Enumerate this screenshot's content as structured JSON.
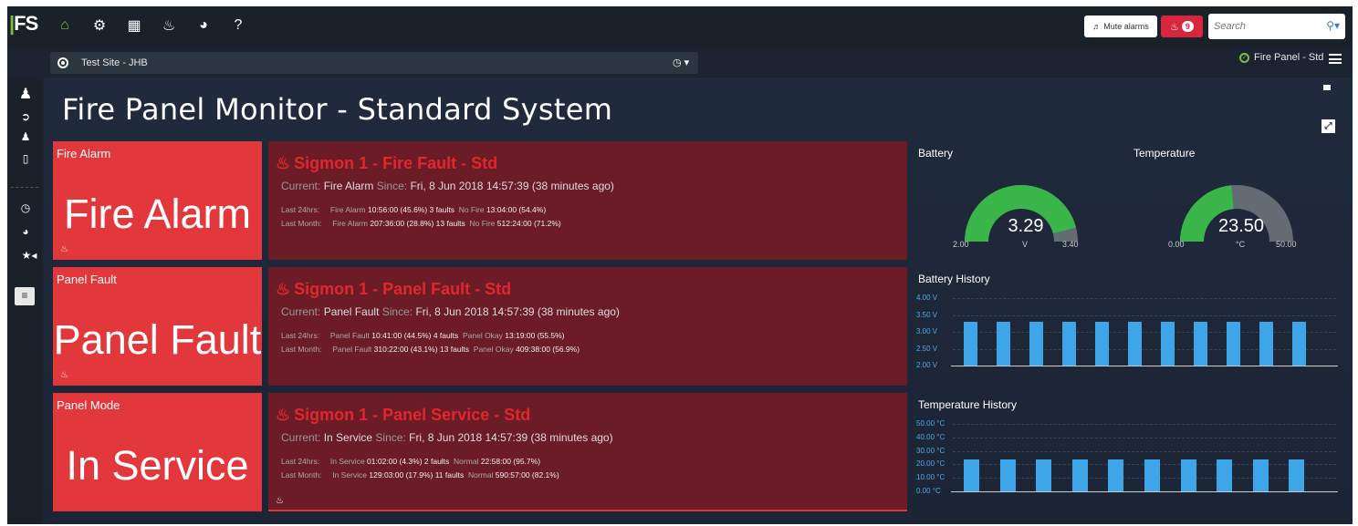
{
  "app": {
    "logo": "FS",
    "nav_icons": [
      "home-icon",
      "gear-icon",
      "table-icon",
      "bell-icon",
      "dashboard-icon",
      "help-icon"
    ],
    "mute_alarms": "Mute alarms",
    "alarm_count": "9",
    "search_placeholder": "Search"
  },
  "site": {
    "name": "Test Site - JHB",
    "panel_selector": "Fire Panel - Std"
  },
  "page": {
    "title": "Fire Panel Monitor - Standard System"
  },
  "tiles": [
    {
      "label": "Fire Alarm",
      "value": "Fire Alarm"
    },
    {
      "label": "Panel Fault",
      "value": "Panel Fault"
    },
    {
      "label": "Panel Mode",
      "value": "In Service"
    }
  ],
  "details": [
    {
      "title": "Sigmon 1 - Fire Fault - Std",
      "current_label": "Current:",
      "current_value": "Fire Alarm",
      "since_label": "Since:",
      "since_value": "Fri, 8 Jun 2018   14:57:39 (38 minutes ago)",
      "l24_label": "Last 24hrs:",
      "l24_a_name": "Fire Alarm",
      "l24_a_val": "10:56:00 (45.6%) 3 faults",
      "l24_b_name": "No Fire",
      "l24_b_val": "13:04:00 (54.4%)",
      "lm_label": "Last Month:",
      "lm_a_name": "Fire Alarm",
      "lm_a_val": "207:36:00 (28.8%) 13 faults",
      "lm_b_name": "No Fire",
      "lm_b_val": "512:24:00 (71.2%)"
    },
    {
      "title": "Sigmon 1 - Panel Fault - Std",
      "current_label": "Current:",
      "current_value": "Panel Fault",
      "since_label": "Since:",
      "since_value": "Fri, 8 Jun 2018   14:57:39 (38 minutes ago)",
      "l24_label": "Last 24hrs:",
      "l24_a_name": "Panel Fault",
      "l24_a_val": "10:41:00 (44.5%) 4 faults",
      "l24_b_name": "Panel Okay",
      "l24_b_val": "13:19:00 (55.5%)",
      "lm_label": "Last Month:",
      "lm_a_name": "Panel Fault",
      "lm_a_val": "310:22:00 (43.1%) 13 faults",
      "lm_b_name": "Panel Okay",
      "lm_b_val": "409:38:00 (56.9%)"
    },
    {
      "title": "Sigmon 1 - Panel Service - Std",
      "current_label": "Current:",
      "current_value": "In Service",
      "since_label": "Since:",
      "since_value": "Fri, 8 Jun 2018   14:57:39 (38 minutes ago)",
      "l24_label": "Last 24hrs:",
      "l24_a_name": "In Service",
      "l24_a_val": "01:02:00 (4.3%) 2 faults",
      "l24_b_name": "Normal",
      "l24_b_val": "22:58:00 (95.7%)",
      "lm_label": "Last Month:",
      "lm_a_name": "In Service",
      "lm_a_val": "129:03:00 (17.9%) 11 faults",
      "lm_b_name": "Normal",
      "lm_b_val": "590:57:00 (82.1%)"
    }
  ],
  "gauges": {
    "battery": {
      "label": "Battery",
      "value": "3.29",
      "unit": "V",
      "min": "2.00",
      "max": "3.40",
      "fraction": 0.92
    },
    "temperature": {
      "label": "Temperature",
      "value": "23.50",
      "unit": "°C",
      "min": "0.00",
      "max": "50.00",
      "fraction": 0.47
    }
  },
  "colors": {
    "gauge_fill": "#3ab54a",
    "gauge_track": "#646c73",
    "bar": "#3ea6e8",
    "tile": "#e2383b",
    "detail_bg": "#6b1c27",
    "detail_title": "#e2262c"
  },
  "chart_data": [
    {
      "type": "bar",
      "title": "Battery History",
      "y_ticks": [
        "4.00 V",
        "3.50 V",
        "3.00 V",
        "2.50 V",
        "2.00 V"
      ],
      "ylim": [
        2.0,
        4.0
      ],
      "values": [
        3.3,
        3.3,
        3.3,
        3.3,
        3.3,
        3.3,
        3.3,
        3.3,
        3.3,
        3.3,
        3.3
      ],
      "grid": true
    },
    {
      "type": "bar",
      "title": "Temperature History",
      "y_ticks": [
        "50.00 °C",
        "40.00 °C",
        "30.00 °C",
        "20.00 °C",
        "10.00 °C",
        "0.00 °C"
      ],
      "ylim": [
        0,
        50
      ],
      "values": [
        23.5,
        23.5,
        23.5,
        23.5,
        23.5,
        23.5,
        23.5,
        23.5,
        23.5,
        23.5
      ],
      "grid": true
    }
  ]
}
